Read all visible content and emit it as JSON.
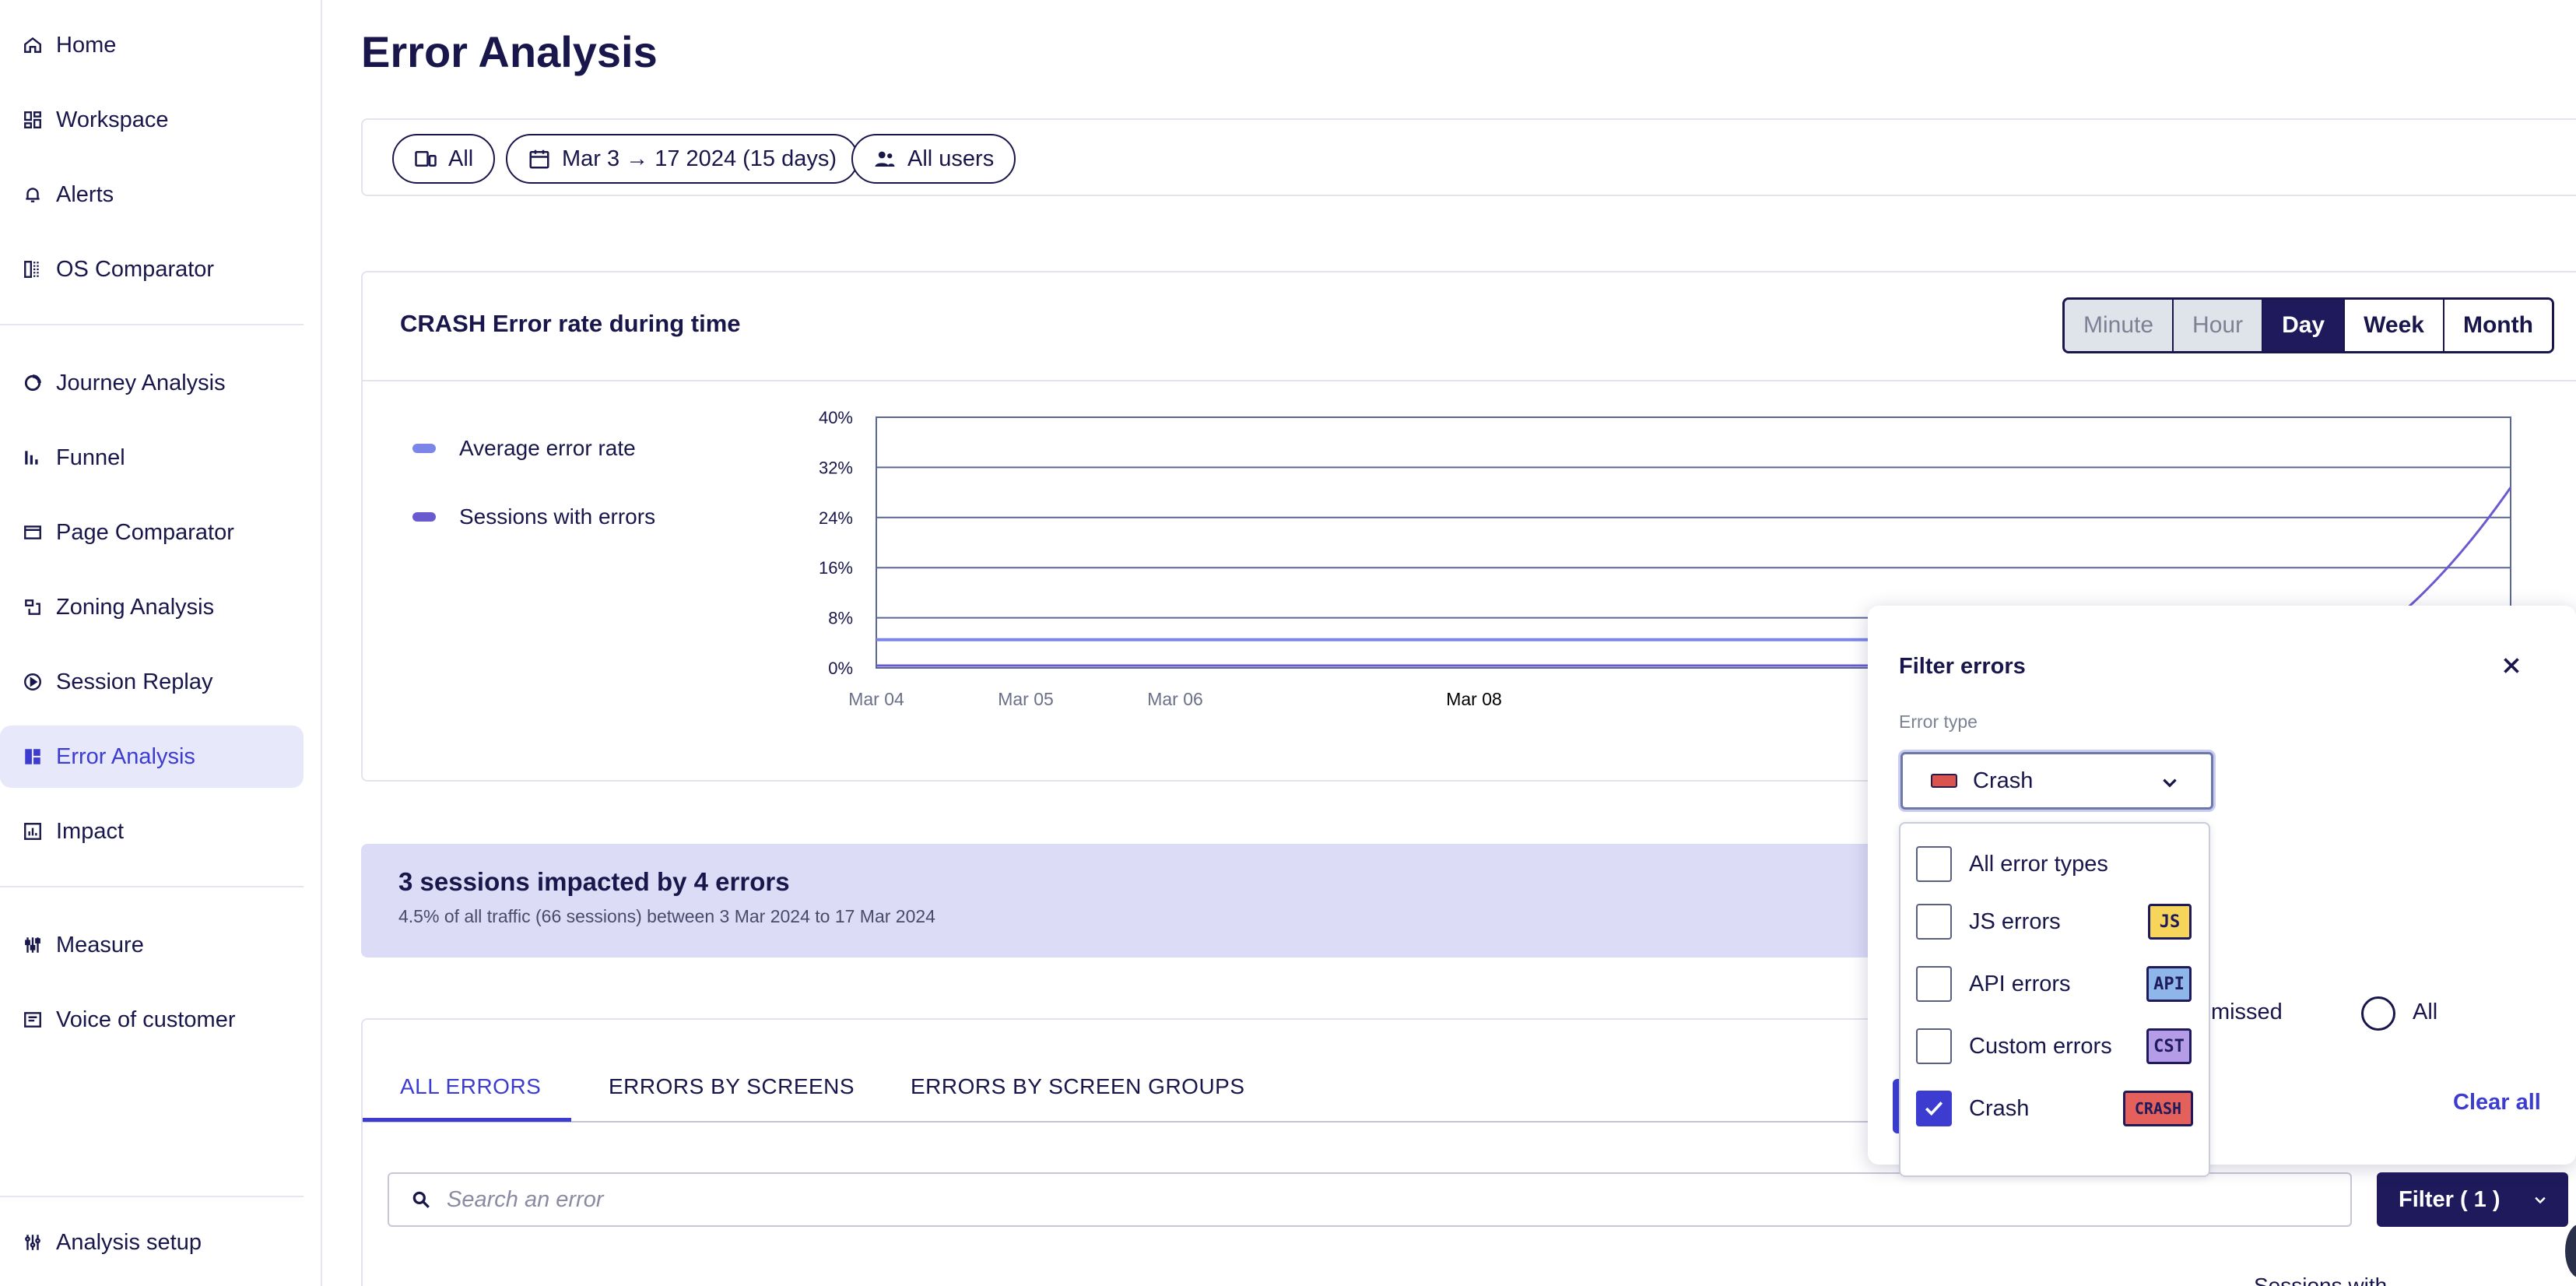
{
  "sidebar": {
    "items": [
      {
        "label": "Home",
        "icon": "home-icon"
      },
      {
        "label": "Workspace",
        "icon": "workspace-icon"
      },
      {
        "label": "Alerts",
        "icon": "bell-icon"
      },
      {
        "label": "OS Comparator",
        "icon": "os-comparator-icon"
      },
      {
        "label": "Journey Analysis",
        "icon": "journey-icon"
      },
      {
        "label": "Funnel",
        "icon": "funnel-icon"
      },
      {
        "label": "Page Comparator",
        "icon": "page-comparator-icon"
      },
      {
        "label": "Zoning Analysis",
        "icon": "zoning-icon"
      },
      {
        "label": "Session Replay",
        "icon": "play-icon"
      },
      {
        "label": "Error Analysis",
        "icon": "error-analysis-icon",
        "active": true
      },
      {
        "label": "Impact",
        "icon": "impact-icon"
      },
      {
        "label": "Measure",
        "icon": "measure-icon"
      },
      {
        "label": "Voice of customer",
        "icon": "voice-icon"
      },
      {
        "label": "Analysis setup",
        "icon": "settings-sliders-icon"
      }
    ]
  },
  "page": {
    "title": "Error Analysis"
  },
  "filters": {
    "device": "All",
    "date_range": "Mar 3 → 17 2024 (15 days)",
    "users": "All users"
  },
  "chart_card": {
    "title": "CRASH Error rate during time",
    "granularity": [
      {
        "label": "Minute",
        "state": "disabled"
      },
      {
        "label": "Hour",
        "state": "disabled"
      },
      {
        "label": "Day",
        "state": "selected"
      },
      {
        "label": "Week",
        "state": "normal"
      },
      {
        "label": "Month",
        "state": "normal"
      }
    ]
  },
  "chart_data": {
    "type": "line",
    "x": [
      "Mar 04",
      "Mar 05",
      "Mar 06",
      "Mar 08"
    ],
    "x_highlight": "Mar 08",
    "yticks": [
      "0%",
      "8%",
      "16%",
      "24%",
      "32%",
      "40%"
    ],
    "ylim": [
      0,
      40
    ],
    "series": [
      {
        "name": "Average error rate",
        "color": "#7b86e8",
        "values": [
          4.5,
          4.5,
          4.5,
          4.5,
          4.5,
          4.5
        ]
      },
      {
        "name": "Sessions with errors",
        "color": "#6a5ad0",
        "values": [
          0,
          0,
          0,
          0,
          0,
          28.8
        ]
      }
    ],
    "grid": true,
    "legend": "left"
  },
  "summary": {
    "title": "3 sessions impacted by 4 errors",
    "subtitle": "4.5% of all traffic (66 sessions) between 3 Mar 2024 to 17 Mar 2024"
  },
  "tabs": [
    {
      "label": "ALL ERRORS",
      "active": true
    },
    {
      "label": "ERRORS BY SCREENS"
    },
    {
      "label": "ERRORS BY SCREEN GROUPS"
    }
  ],
  "search": {
    "placeholder": "Search an error"
  },
  "filter_button": {
    "label": "Filter ( 1 )"
  },
  "sessions_peek": "Sessions with",
  "filter_popover": {
    "title": "Filter errors",
    "error_type_label": "Error type",
    "selected_value": "Crash",
    "options": [
      {
        "label": "All error types",
        "checked": false
      },
      {
        "label": "JS errors",
        "checked": false,
        "badge": "JS"
      },
      {
        "label": "API errors",
        "checked": false,
        "badge": "API"
      },
      {
        "label": "Custom errors",
        "checked": false,
        "badge": "CST"
      },
      {
        "label": "Crash",
        "checked": true,
        "badge": "CRASH"
      }
    ],
    "status_partial": "ismissed",
    "status_all": "All",
    "clear_all": "Clear all"
  },
  "colors": {
    "accent": "#3c3cd0",
    "navy": "#1f1a5c",
    "summary_bg": "#dcdcf7"
  }
}
